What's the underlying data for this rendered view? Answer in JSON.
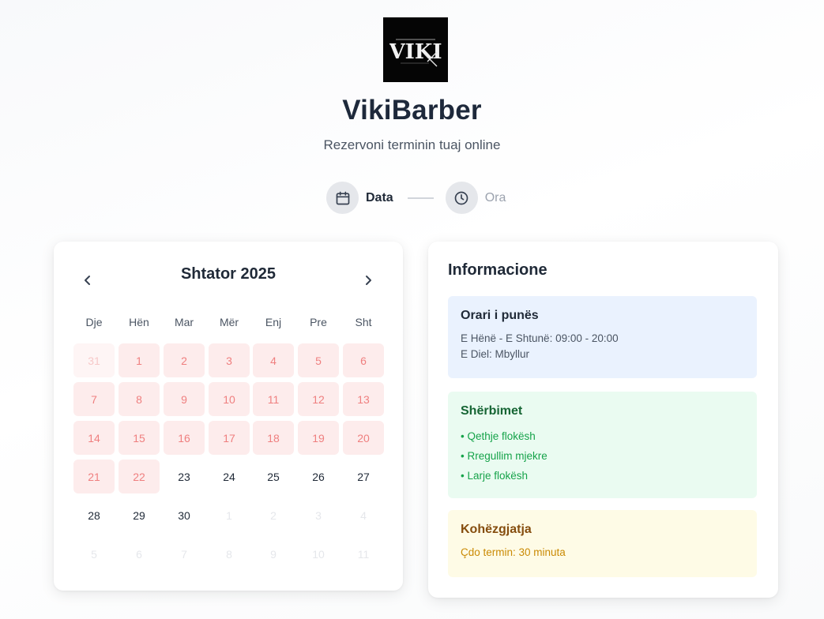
{
  "brand": {
    "logo_text": "VIKI",
    "title": "VikiBarber",
    "subtitle": "Rezervoni terminin tuaj online"
  },
  "steps": [
    {
      "label": "Data",
      "icon": "calendar-icon",
      "active": true
    },
    {
      "label": "Ora",
      "icon": "clock-icon",
      "active": false
    }
  ],
  "calendar": {
    "month_label": "Shtator 2025",
    "weekdays": [
      "Dje",
      "Hën",
      "Mar",
      "Mër",
      "Enj",
      "Pre",
      "Sht"
    ],
    "weeks": [
      [
        "31",
        "1",
        "2",
        "3",
        "4",
        "5",
        "6"
      ],
      [
        "7",
        "8",
        "9",
        "10",
        "11",
        "12",
        "13"
      ],
      [
        "14",
        "15",
        "16",
        "17",
        "18",
        "19",
        "20"
      ],
      [
        "21",
        "22",
        "23",
        "24",
        "25",
        "26",
        "27"
      ],
      [
        "28",
        "29",
        "30",
        "1",
        "2",
        "3",
        "4"
      ],
      [
        "5",
        "6",
        "7",
        "8",
        "9",
        "10",
        "11"
      ]
    ]
  },
  "info": {
    "title": "Informacione",
    "hours": {
      "title": "Orari i punës",
      "line1": "E Hënë - E Shtunë: 09:00 - 20:00",
      "line2": "E Diel: Mbyllur"
    },
    "services": {
      "title": "Shërbimet",
      "items": [
        "• Qethje flokësh",
        "• Rregullim mjekre",
        "• Larje flokësh"
      ]
    },
    "duration": {
      "title": "Kohëzgjatja",
      "text": "Çdo termin: 30 minuta"
    }
  },
  "colors": {
    "past_day_bg": "#fdecec",
    "past_day_text": "#ef7f7f",
    "blue_panel": "#eaf2fe",
    "green_panel": "#eafbf1",
    "yellow_panel": "#fefbe6"
  }
}
